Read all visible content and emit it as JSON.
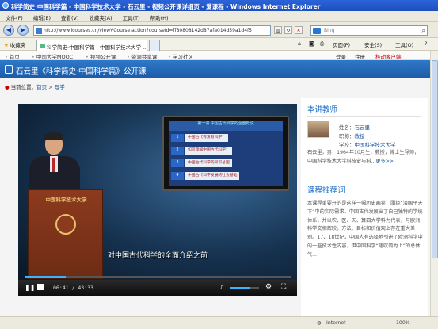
{
  "window": {
    "title": "科学简史·中国科学篇 - 中国科学技术大学 - 石云里 - 视频公开课详细页 - 爱课程 - Windows Internet Explorer"
  },
  "menu": [
    "文件(F)",
    "编辑(E)",
    "查看(V)",
    "收藏夹(A)",
    "工具(T)",
    "帮助(H)"
  ],
  "address": {
    "url": "http://www.icourses.cn/viewVCourse.action?courseId=ff80808142d87afa014d59a1d4f5",
    "search_placeholder": "Bing"
  },
  "favorites": {
    "label": "收藏夹"
  },
  "tabs": [
    {
      "label": "科学简史·中国科学篇 - 中国科学技术大学 ..."
    }
  ],
  "toolbar": {
    "page": "页面(P)",
    "safety": "安全(S)",
    "tools": "工具(O)"
  },
  "site_nav": {
    "items": [
      "首页",
      "中国大学MOOC",
      "视频公开课",
      "资源共享课",
      "学习社区"
    ],
    "login": "登录",
    "register": "注册",
    "mobile": "移动客户端"
  },
  "course": {
    "title": "石云里《科学简史·中国科学篇》公开课"
  },
  "breadcrumb": {
    "label": "当前位置：",
    "home": "首页",
    "sep": " > ",
    "category": "理学"
  },
  "video": {
    "slide_header": "第一讲\n中国古代科学的全面概说",
    "slide_items": [
      {
        "n": "1",
        "text": "中国古代有没有科学？"
      },
      {
        "n": "2",
        "text": "如何理解中国古代科学？"
      },
      {
        "n": "3",
        "text": "中国古代科学的知识总图"
      },
      {
        "n": "4",
        "text": "中国古代科学发展的社会基础"
      }
    ],
    "podium_text": "中国科学技术大学",
    "subtitle": "对中国古代科学的全面介绍之前",
    "current_time": "06:41",
    "duration": "43:33",
    "progress": 0.154,
    "volume": 0.7
  },
  "teacher": {
    "heading": "本讲教师",
    "name_label": "姓名：",
    "name": "石云里",
    "title_label": "职称：",
    "title": "教授",
    "school_label": "学校：",
    "school": "中国科学技术大学",
    "bio": "石云里，男，1964年10月生，教授，博士生导师，中国科学技术大学科技史与科...",
    "more": "更多>>"
  },
  "recommend": {
    "heading": "课程推荐词",
    "text": "本课程重要开的是这样一幅历史画卷：围绕“治国平天下”中的实际需求，中国古代发展出了自己独特的学统体系，并以农、医、天、算四大学科为代表，与欧洲科学交相辉映。方法、目标和价值观上存在重大差别。17、18世纪，中国人有选择地引进了欧洲科学中的一些技术性内容，但中国科学“嗟叹简为上”的总体气..."
  },
  "status": {
    "zone": "Internet",
    "zoom": "100%"
  }
}
